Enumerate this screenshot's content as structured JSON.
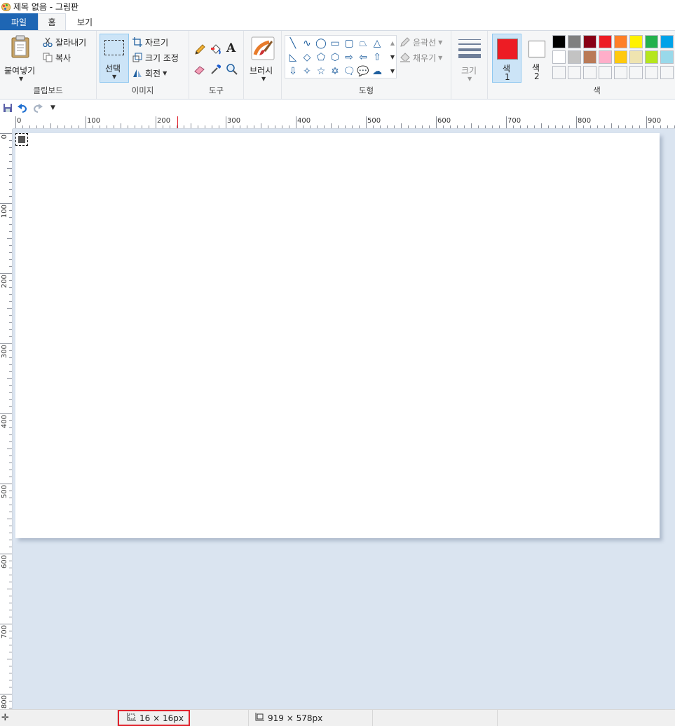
{
  "window": {
    "title": "제목 없음 - 그림판"
  },
  "menu": {
    "file": "파일",
    "home": "홈",
    "view": "보기"
  },
  "clipboard": {
    "paste": "붙여넣기",
    "cut": "잘라내기",
    "copy": "복사",
    "label": "클립보드"
  },
  "image": {
    "select": "선택",
    "crop": "자르기",
    "resize": "크기 조정",
    "rotate": "회전",
    "label": "이미지"
  },
  "tools": {
    "label": "도구",
    "text_glyph": "A"
  },
  "brush": {
    "label": "브러시"
  },
  "shapes": {
    "outline": "윤곽선",
    "fill": "채우기",
    "label": "도형"
  },
  "size": {
    "label": "크기"
  },
  "colors": {
    "color1_label": "색",
    "color1_num": "1",
    "color2_label": "색",
    "color2_num": "2",
    "label": "색",
    "color1": "#ed1c24",
    "color2": "#ffffff",
    "palette_row1": [
      "#000000",
      "#7f7f7f",
      "#880015",
      "#ed1c24",
      "#ff7f27",
      "#fff200",
      "#22b14c",
      "#00a2e8"
    ],
    "palette_row2": [
      "#ffffff",
      "#c3c3c3",
      "#b97a57",
      "#ffaec9",
      "#ffc90e",
      "#efe4b0",
      "#b5e61d",
      "#99d9ea"
    ]
  },
  "ruler": {
    "h_labels": [
      "0",
      "100",
      "200",
      "300",
      "400",
      "500",
      "600",
      "700",
      "800",
      "900"
    ],
    "v_labels": [
      "0",
      "100",
      "200",
      "300",
      "400",
      "500",
      "600",
      "700",
      "800"
    ]
  },
  "status": {
    "selection_size": "16 × 16px",
    "canvas_size": "919 × 578px"
  }
}
